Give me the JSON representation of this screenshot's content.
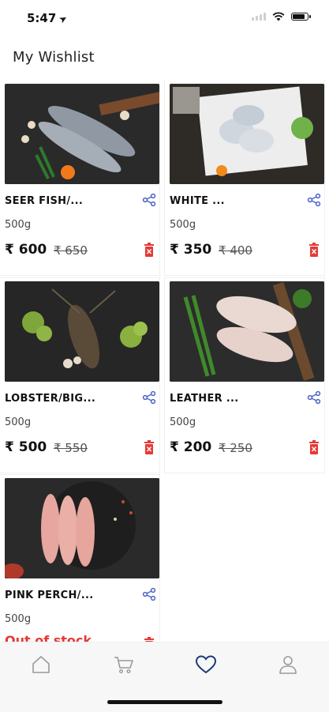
{
  "status": {
    "time": "5:47",
    "location_icon": "location-arrow-icon"
  },
  "header": {
    "title": "My Wishlist"
  },
  "currency": "₹",
  "products": [
    {
      "name": "SEER FISH/...",
      "weight": "500g",
      "price": "₹ 600",
      "mrp": "₹ 650",
      "image": "seer-fish-photo"
    },
    {
      "name": "WHITE ...",
      "weight": "500g",
      "price": "₹ 350",
      "mrp": "₹ 400",
      "image": "white-pomfret-photo"
    },
    {
      "name": "LOBSTER/BIG...",
      "weight": "500g",
      "price": "₹ 500",
      "mrp": "₹ 550",
      "image": "lobster-photo"
    },
    {
      "name": "LEATHER ...",
      "weight": "500g",
      "price": "₹ 200",
      "mrp": "₹ 250",
      "image": "leather-jacket-fish-photo"
    },
    {
      "name": "PINK PERCH/...",
      "weight": "500g",
      "status": "Out of stock",
      "image": "pink-perch-photo"
    }
  ],
  "tabbar": {
    "items": [
      {
        "name": "home",
        "icon": "home-icon",
        "active": false
      },
      {
        "name": "cart",
        "icon": "cart-icon",
        "active": false
      },
      {
        "name": "wishlist",
        "icon": "heart-icon",
        "active": true
      },
      {
        "name": "profile",
        "icon": "user-icon",
        "active": false
      }
    ]
  },
  "colors": {
    "accent": "#4a63c9",
    "danger": "#e53935",
    "active_tab": "#1f3a78",
    "inactive_tab": "#9a9a9a"
  }
}
